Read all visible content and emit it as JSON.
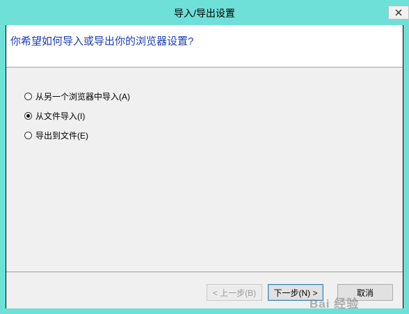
{
  "window": {
    "title": "导入/导出设置",
    "close_icon": "close-icon"
  },
  "header": {
    "question": "你希望如何导入或导出你的浏览器设置?"
  },
  "options": [
    {
      "label": "从另一个浏览器中导入(A)",
      "selected": false
    },
    {
      "label": "从文件导入(I)",
      "selected": true
    },
    {
      "label": "导出到文件(E)",
      "selected": false
    }
  ],
  "buttons": {
    "back": "< 上一步(B)",
    "next": "下一步(N) >",
    "cancel": "取消"
  },
  "watermark": "Bai 经验"
}
